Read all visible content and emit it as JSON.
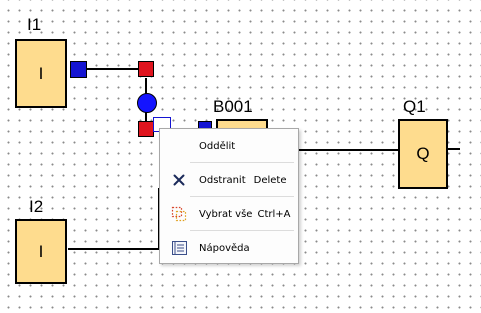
{
  "blocks": {
    "i1": {
      "name": "I1",
      "symbol": "I"
    },
    "i2": {
      "name": "I2",
      "symbol": "I"
    },
    "b001": {
      "name": "B001"
    },
    "q1": {
      "name": "Q1",
      "symbol": "Q"
    }
  },
  "context_menu": {
    "items": [
      {
        "label": "Oddělit",
        "shortcut": ""
      },
      {
        "label": "Odstranit",
        "shortcut": "Delete",
        "icon": "delete-x-icon"
      },
      {
        "label": "Vybrat vše",
        "shortcut": "Ctrl+A",
        "icon": "select-all-icon"
      },
      {
        "label": "Nápověda",
        "shortcut": "",
        "icon": "help-book-icon"
      }
    ]
  },
  "colors": {
    "block_fill": "#fedc8e",
    "input_connector": "#1414d2",
    "output_connector": "#e0141e",
    "selection_handle": "#1414ff"
  }
}
